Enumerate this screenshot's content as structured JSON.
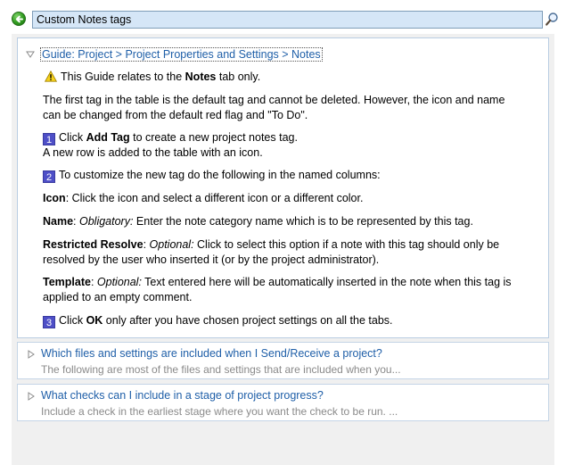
{
  "search": {
    "value": "Custom Notes tags"
  },
  "icons": {
    "back": "green-back-arrow-icon",
    "search": "magnifier-icon",
    "warning": "warning-triangle-icon",
    "expanded": "triangle-down-icon",
    "collapsed": "triangle-right-icon"
  },
  "colors": {
    "link": "#1f5fa8",
    "search_bg": "#d5e6f7",
    "step_badge": "#4e4fc7",
    "panel_border": "#b9cde2"
  },
  "guide": {
    "title": "Guide: Project > Project Properties and Settings > Notes",
    "warning_pre": "This Guide relates to the ",
    "warning_bold": "Notes",
    "warning_post": " tab only.",
    "intro_line1": "The first tag in the table is the default tag and cannot be deleted. However, the icon and name",
    "intro_line2": "can be changed from the default red flag and \"To Do\".",
    "step1_num": "1",
    "step1_pre": "Click ",
    "step1_bold": "Add Tag",
    "step1_post": " to create a new project notes tag.",
    "step1_line2": "A new row is added to the table with an icon.",
    "step2_num": "2",
    "step2_text": "To customize the new tag do the following in the named columns:",
    "icon_label": "Icon",
    "icon_text": ": Click the icon and select a different icon or a different color.",
    "name_label": "Name",
    "name_colon": ": ",
    "name_italic": "Obligatory:",
    "name_text": " Enter the note category name which is to be represented by this tag.",
    "rr_label": "Restricted Resolve",
    "rr_colon": ": ",
    "rr_italic": "Optional:",
    "rr_text": " Click to select this option if a note with this tag should only be",
    "rr_line2": "resolved by the user who inserted it (or by the project administrator).",
    "tpl_label": "Template",
    "tpl_colon": ": ",
    "tpl_italic": "Optional:",
    "tpl_text": " Text entered here will be automatically inserted in the note when this tag is",
    "tpl_line2": "applied to an empty comment.",
    "step3_num": "3",
    "step3_pre": "Click ",
    "step3_bold": "OK",
    "step3_post": " only after you have chosen project settings on all the tabs."
  },
  "results": [
    {
      "title": "Which files and settings are included when I Send/Receive a project?",
      "snippet": "The following are most of the files and settings that are included when you..."
    },
    {
      "title": "What checks can I include in a stage of project progress?",
      "snippet": "Include a check in the earliest stage where you want the check to be run. ..."
    }
  ]
}
